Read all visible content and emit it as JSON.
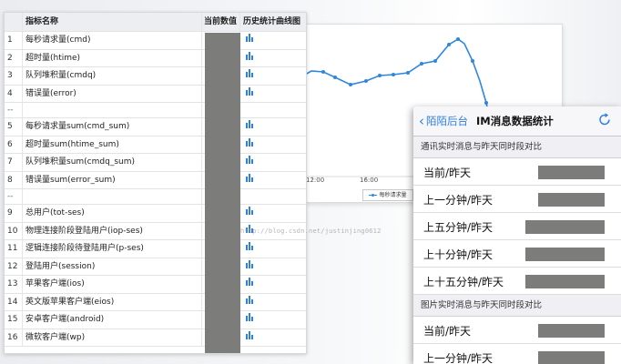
{
  "table": {
    "headers": {
      "name": "指标名称",
      "current": "当前数值",
      "history": "历史统计曲线图"
    },
    "rows": [
      {
        "idx": "1",
        "name": "每秒请求量(cmd)"
      },
      {
        "idx": "2",
        "name": "超时量(htime)"
      },
      {
        "idx": "3",
        "name": "队列堆积量(cmdq)"
      },
      {
        "idx": "4",
        "name": "错误量(error)"
      },
      {
        "idx": "--",
        "name": ""
      },
      {
        "idx": "5",
        "name": "每秒请求量sum(cmd_sum)"
      },
      {
        "idx": "6",
        "name": "超时量sum(htime_sum)"
      },
      {
        "idx": "7",
        "name": "队列堆积量sum(cmdq_sum)"
      },
      {
        "idx": "8",
        "name": "错误量sum(error_sum)"
      },
      {
        "idx": "--",
        "name": ""
      },
      {
        "idx": "9",
        "name": "总用户(tot-ses)"
      },
      {
        "idx": "10",
        "name": "物理连接阶段登陆用户(iop-ses)"
      },
      {
        "idx": "11",
        "name": "逻辑连接阶段待登陆用户(p-ses)"
      },
      {
        "idx": "12",
        "name": "登陆用户(session)"
      },
      {
        "idx": "13",
        "name": "苹果客户端(ios)"
      },
      {
        "idx": "14",
        "name": "英文版苹果客户端(eios)"
      },
      {
        "idx": "15",
        "name": "安卓客户端(android)"
      },
      {
        "idx": "16",
        "name": "微软客户端(wp)"
      }
    ],
    "chart_icon": "bar-chart-icon",
    "icon_color": "#2f7fdc"
  },
  "background_chart": {
    "x_ticks": [
      "12:00",
      "16:00"
    ],
    "legend": "每秒请求量",
    "line_color": "#2e86de"
  },
  "watermark": "http://blog.csdn.net/justinjing0612",
  "phone": {
    "back_label": "陌陌后台",
    "title": "IM消息数据统计",
    "refresh_icon": "refresh-icon",
    "sections": [
      {
        "header": "通讯实时消息与昨天同时段对比",
        "rows": [
          {
            "label": "当前/昨天"
          },
          {
            "label": "上一分钟/昨天"
          },
          {
            "label": "上五分钟/昨天"
          },
          {
            "label": "上十分钟/昨天"
          },
          {
            "label": "上十五分钟/昨天"
          }
        ]
      },
      {
        "header": "图片实时消息与昨天同时段对比",
        "rows": [
          {
            "label": "当前/昨天"
          },
          {
            "label": "上一分钟/昨天"
          }
        ]
      }
    ]
  }
}
